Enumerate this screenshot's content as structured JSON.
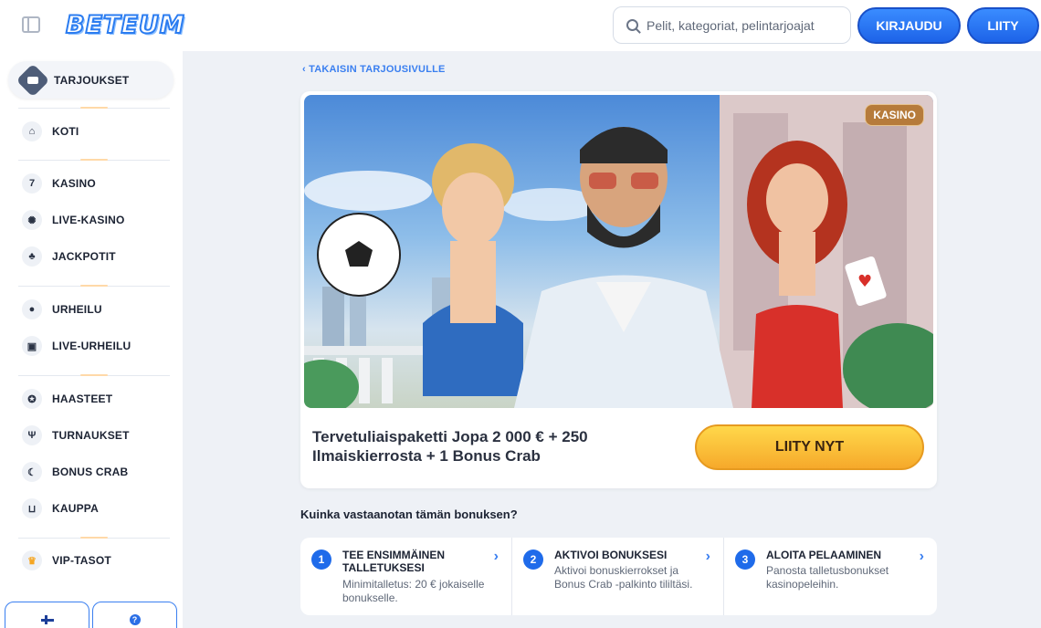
{
  "header": {
    "logo": "BETEUM",
    "search_placeholder": "Pelit, kategoriat, pelintarjoajat",
    "login_label": "KIRJAUDU",
    "join_label": "LIITY"
  },
  "sidebar": {
    "promo_label": "TARJOUKSET",
    "items": [
      {
        "label": "KOTI",
        "icon": "home-icon"
      },
      {
        "label": "KASINO",
        "icon": "seven-icon"
      },
      {
        "label": "LIVE-KASINO",
        "icon": "chip-icon"
      },
      {
        "label": "JACKPOTIT",
        "icon": "clover-icon"
      },
      {
        "label": "URHEILU",
        "icon": "ball-icon"
      },
      {
        "label": "LIVE-URHEILU",
        "icon": "live-icon"
      },
      {
        "label": "HAASTEET",
        "icon": "medal-icon"
      },
      {
        "label": "TURNAUKSET",
        "icon": "trophy-icon"
      },
      {
        "label": "BONUS CRAB",
        "icon": "crab-icon"
      },
      {
        "label": "KAUPPA",
        "icon": "basket-icon"
      },
      {
        "label": "VIP-TASOT",
        "icon": "crown-icon"
      }
    ]
  },
  "main": {
    "back_link": "TAKAISIN TARJOUSIVULLE",
    "badge": "KASINO",
    "offer_title": "Tervetuliaispaketti Jopa 2 000 € + 250 Ilmaiskierrosta + 1 Bonus Crab",
    "cta_label": "LIITY NYT",
    "how_title": "Kuinka vastaanotan tämän bonuksen?",
    "steps": [
      {
        "num": "1",
        "title": "TEE ENSIMMÄINEN TALLETUKSESI",
        "desc": "Minimitalletus: 20 € jokaiselle bonukselle."
      },
      {
        "num": "2",
        "title": "AKTIVOI BONUKSESI",
        "desc": "Aktivoi bonuskierrokset ja Bonus Crab -palkinto tililtäsi."
      },
      {
        "num": "3",
        "title": "ALOITA PELAAMINEN",
        "desc": "Panosta talletusbonukset kasinopeleihin."
      }
    ]
  },
  "colors": {
    "accent": "#1f6bea",
    "cta": "#f6a92b",
    "badge": "#b67b3b"
  }
}
